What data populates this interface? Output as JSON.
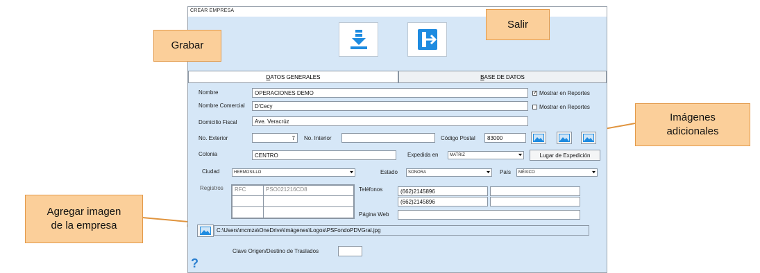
{
  "window": {
    "title": "CREAR EMPRESA"
  },
  "toolbar": {
    "save_icon": "download-icon",
    "exit_icon": "exit-door-icon",
    "accent": "#1e8be0"
  },
  "tabs": [
    {
      "label": "DATOS GENERALES",
      "active": true
    },
    {
      "label": "BASE DE DATOS",
      "active": false
    }
  ],
  "form": {
    "nombre_label": "Nombre",
    "nombre_value": "OPERACIONES DEMO",
    "nombre_comercial_label": "Nombre Comercial",
    "nombre_comercial_value": "D'Cecy",
    "mostrar_reportes_1": {
      "label": "Mostrar en Reportes",
      "checked": true
    },
    "mostrar_reportes_2": {
      "label": "Mostrar en Reportes",
      "checked": false
    },
    "domicilio_label": "Domicilio Fiscal",
    "domicilio_value": "Ave. Veracrúz",
    "no_exterior_label": "No. Exterior",
    "no_exterior_value": "7",
    "no_interior_label": "No. Interior",
    "no_interior_value": "",
    "codigo_postal_label": "Código Postal",
    "codigo_postal_value": "83000",
    "colonia_label": "Colonia",
    "colonia_value": "CENTRO",
    "expedida_label": "Expedida en",
    "expedida_value": "MATRIZ",
    "lugar_expedicion_button": "Lugar de Expedición",
    "ciudad_label": "Ciudad",
    "ciudad_value": "HERMOSILLO",
    "estado_label": "Estado",
    "estado_value": "SONORA",
    "pais_label": "País",
    "pais_value": "MÉXICO",
    "registros_label": "Registros",
    "registros_rows": [
      {
        "tipo": "RFC",
        "valor": "PSO021216CD8"
      },
      {
        "tipo": "",
        "valor": ""
      },
      {
        "tipo": "",
        "valor": ""
      }
    ],
    "telefonos_label": "Teléfonos",
    "telefonos": [
      "(662)2145896",
      "(662)2145896",
      "",
      ""
    ],
    "pagina_web_label": "Página Web",
    "pagina_web_value": "",
    "imagen_path": "C:\\Users\\mcmza\\OneDrive\\Imágenes\\Logos\\PSFondoPDVGral.jpg",
    "clave_label": "Clave Origen/Destino de Traslados",
    "clave_value": ""
  },
  "help": {
    "label": "?"
  },
  "callouts": {
    "grabar": "Grabar",
    "salir": "Salir",
    "imagenes_line1": "Imágenes",
    "imagenes_line2": "adicionales",
    "agregar_line1": "Agregar imagen",
    "agregar_line2": "de la empresa"
  }
}
